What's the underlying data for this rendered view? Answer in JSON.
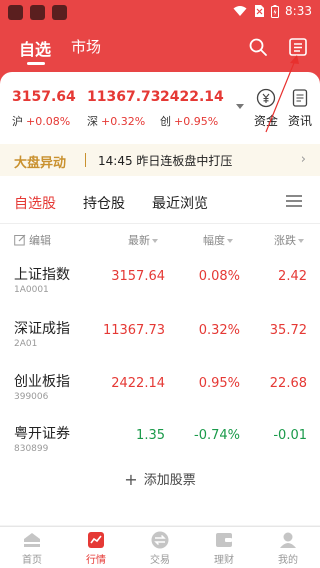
{
  "status_bar": {
    "time": "8:33"
  },
  "header": {
    "tabs": [
      {
        "label": "自选"
      },
      {
        "label": "市场"
      }
    ]
  },
  "indices": [
    {
      "value": "3157.64",
      "name": "沪",
      "change_pct": "+0.08%"
    },
    {
      "value": "11367.73",
      "name": "深",
      "change_pct": "+0.32%"
    },
    {
      "value": "2422.14",
      "name": "创",
      "change_pct": "+0.95%"
    }
  ],
  "quick_buttons": [
    {
      "label": "资金",
      "icon": "yuan-coin-icon"
    },
    {
      "label": "资讯",
      "icon": "news-doc-icon"
    }
  ],
  "market_bar": {
    "tag": "大盘异动",
    "news": "14:45  昨日连板盘中打压"
  },
  "list_tabs": [
    {
      "label": "自选股"
    },
    {
      "label": "持仓股"
    },
    {
      "label": "最近浏览"
    }
  ],
  "columns": {
    "edit": "编辑",
    "price": "最新",
    "pct": "幅度",
    "change": "涨跌"
  },
  "stocks": [
    {
      "name": "上证指数",
      "code": "1A0001",
      "price": "3157.64",
      "pct": "0.08%",
      "change": "2.42",
      "trend": "up"
    },
    {
      "name": "深证成指",
      "code": "2A01",
      "price": "11367.73",
      "pct": "0.32%",
      "change": "35.72",
      "trend": "up"
    },
    {
      "name": "创业板指",
      "code": "399006",
      "price": "2422.14",
      "pct": "0.95%",
      "change": "22.68",
      "trend": "up"
    },
    {
      "name": "粤开证券",
      "code": "830899",
      "price": "1.35",
      "pct": "-0.74%",
      "change": "-0.01",
      "trend": "down"
    }
  ],
  "add_stock": "添加股票",
  "bottom_nav": [
    {
      "label": "首页",
      "icon": "home-icon"
    },
    {
      "label": "行情",
      "icon": "market-trend-icon",
      "active": true
    },
    {
      "label": "交易",
      "icon": "exchange-icon"
    },
    {
      "label": "理财",
      "icon": "wallet-icon"
    },
    {
      "label": "我的",
      "icon": "profile-icon"
    }
  ],
  "colors": {
    "brand_red": "#e84545",
    "up": "#e53935",
    "down": "#1a9a4a",
    "gold": "#c9912f"
  }
}
